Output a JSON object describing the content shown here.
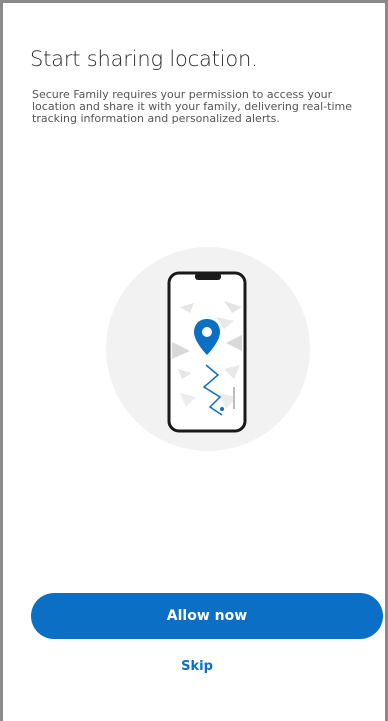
{
  "onboarding": {
    "title": "Start sharing location.",
    "description": "Secure Family requires your permission to access your location and share it with your family, delivering real-time tracking information and personalized alerts.",
    "allow_label": "Allow now",
    "skip_label": "Skip"
  },
  "illustration": {
    "icon": "phone-map-location-pin-icon"
  },
  "colors": {
    "accent": "#0b6fc5",
    "title_text": "#2b2b2b",
    "body_text": "#555555",
    "illustration_bg": "#f2f2f2"
  }
}
